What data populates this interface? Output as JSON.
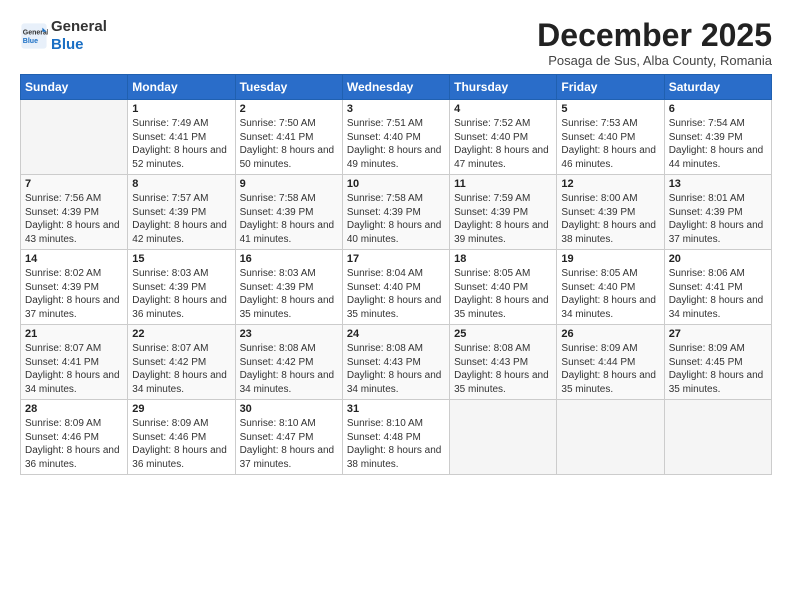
{
  "logo": {
    "line1": "General",
    "line2": "Blue"
  },
  "title": "December 2025",
  "location": "Posaga de Sus, Alba County, Romania",
  "weekdays": [
    "Sunday",
    "Monday",
    "Tuesday",
    "Wednesday",
    "Thursday",
    "Friday",
    "Saturday"
  ],
  "weeks": [
    [
      {
        "day": "",
        "sunrise": "",
        "sunset": "",
        "daylight": ""
      },
      {
        "day": "1",
        "sunrise": "Sunrise: 7:49 AM",
        "sunset": "Sunset: 4:41 PM",
        "daylight": "Daylight: 8 hours and 52 minutes."
      },
      {
        "day": "2",
        "sunrise": "Sunrise: 7:50 AM",
        "sunset": "Sunset: 4:41 PM",
        "daylight": "Daylight: 8 hours and 50 minutes."
      },
      {
        "day": "3",
        "sunrise": "Sunrise: 7:51 AM",
        "sunset": "Sunset: 4:40 PM",
        "daylight": "Daylight: 8 hours and 49 minutes."
      },
      {
        "day": "4",
        "sunrise": "Sunrise: 7:52 AM",
        "sunset": "Sunset: 4:40 PM",
        "daylight": "Daylight: 8 hours and 47 minutes."
      },
      {
        "day": "5",
        "sunrise": "Sunrise: 7:53 AM",
        "sunset": "Sunset: 4:40 PM",
        "daylight": "Daylight: 8 hours and 46 minutes."
      },
      {
        "day": "6",
        "sunrise": "Sunrise: 7:54 AM",
        "sunset": "Sunset: 4:39 PM",
        "daylight": "Daylight: 8 hours and 44 minutes."
      }
    ],
    [
      {
        "day": "7",
        "sunrise": "Sunrise: 7:56 AM",
        "sunset": "Sunset: 4:39 PM",
        "daylight": "Daylight: 8 hours and 43 minutes."
      },
      {
        "day": "8",
        "sunrise": "Sunrise: 7:57 AM",
        "sunset": "Sunset: 4:39 PM",
        "daylight": "Daylight: 8 hours and 42 minutes."
      },
      {
        "day": "9",
        "sunrise": "Sunrise: 7:58 AM",
        "sunset": "Sunset: 4:39 PM",
        "daylight": "Daylight: 8 hours and 41 minutes."
      },
      {
        "day": "10",
        "sunrise": "Sunrise: 7:58 AM",
        "sunset": "Sunset: 4:39 PM",
        "daylight": "Daylight: 8 hours and 40 minutes."
      },
      {
        "day": "11",
        "sunrise": "Sunrise: 7:59 AM",
        "sunset": "Sunset: 4:39 PM",
        "daylight": "Daylight: 8 hours and 39 minutes."
      },
      {
        "day": "12",
        "sunrise": "Sunrise: 8:00 AM",
        "sunset": "Sunset: 4:39 PM",
        "daylight": "Daylight: 8 hours and 38 minutes."
      },
      {
        "day": "13",
        "sunrise": "Sunrise: 8:01 AM",
        "sunset": "Sunset: 4:39 PM",
        "daylight": "Daylight: 8 hours and 37 minutes."
      }
    ],
    [
      {
        "day": "14",
        "sunrise": "Sunrise: 8:02 AM",
        "sunset": "Sunset: 4:39 PM",
        "daylight": "Daylight: 8 hours and 37 minutes."
      },
      {
        "day": "15",
        "sunrise": "Sunrise: 8:03 AM",
        "sunset": "Sunset: 4:39 PM",
        "daylight": "Daylight: 8 hours and 36 minutes."
      },
      {
        "day": "16",
        "sunrise": "Sunrise: 8:03 AM",
        "sunset": "Sunset: 4:39 PM",
        "daylight": "Daylight: 8 hours and 35 minutes."
      },
      {
        "day": "17",
        "sunrise": "Sunrise: 8:04 AM",
        "sunset": "Sunset: 4:40 PM",
        "daylight": "Daylight: 8 hours and 35 minutes."
      },
      {
        "day": "18",
        "sunrise": "Sunrise: 8:05 AM",
        "sunset": "Sunset: 4:40 PM",
        "daylight": "Daylight: 8 hours and 35 minutes."
      },
      {
        "day": "19",
        "sunrise": "Sunrise: 8:05 AM",
        "sunset": "Sunset: 4:40 PM",
        "daylight": "Daylight: 8 hours and 34 minutes."
      },
      {
        "day": "20",
        "sunrise": "Sunrise: 8:06 AM",
        "sunset": "Sunset: 4:41 PM",
        "daylight": "Daylight: 8 hours and 34 minutes."
      }
    ],
    [
      {
        "day": "21",
        "sunrise": "Sunrise: 8:07 AM",
        "sunset": "Sunset: 4:41 PM",
        "daylight": "Daylight: 8 hours and 34 minutes."
      },
      {
        "day": "22",
        "sunrise": "Sunrise: 8:07 AM",
        "sunset": "Sunset: 4:42 PM",
        "daylight": "Daylight: 8 hours and 34 minutes."
      },
      {
        "day": "23",
        "sunrise": "Sunrise: 8:08 AM",
        "sunset": "Sunset: 4:42 PM",
        "daylight": "Daylight: 8 hours and 34 minutes."
      },
      {
        "day": "24",
        "sunrise": "Sunrise: 8:08 AM",
        "sunset": "Sunset: 4:43 PM",
        "daylight": "Daylight: 8 hours and 34 minutes."
      },
      {
        "day": "25",
        "sunrise": "Sunrise: 8:08 AM",
        "sunset": "Sunset: 4:43 PM",
        "daylight": "Daylight: 8 hours and 35 minutes."
      },
      {
        "day": "26",
        "sunrise": "Sunrise: 8:09 AM",
        "sunset": "Sunset: 4:44 PM",
        "daylight": "Daylight: 8 hours and 35 minutes."
      },
      {
        "day": "27",
        "sunrise": "Sunrise: 8:09 AM",
        "sunset": "Sunset: 4:45 PM",
        "daylight": "Daylight: 8 hours and 35 minutes."
      }
    ],
    [
      {
        "day": "28",
        "sunrise": "Sunrise: 8:09 AM",
        "sunset": "Sunset: 4:46 PM",
        "daylight": "Daylight: 8 hours and 36 minutes."
      },
      {
        "day": "29",
        "sunrise": "Sunrise: 8:09 AM",
        "sunset": "Sunset: 4:46 PM",
        "daylight": "Daylight: 8 hours and 36 minutes."
      },
      {
        "day": "30",
        "sunrise": "Sunrise: 8:10 AM",
        "sunset": "Sunset: 4:47 PM",
        "daylight": "Daylight: 8 hours and 37 minutes."
      },
      {
        "day": "31",
        "sunrise": "Sunrise: 8:10 AM",
        "sunset": "Sunset: 4:48 PM",
        "daylight": "Daylight: 8 hours and 38 minutes."
      },
      {
        "day": "",
        "sunrise": "",
        "sunset": "",
        "daylight": ""
      },
      {
        "day": "",
        "sunrise": "",
        "sunset": "",
        "daylight": ""
      },
      {
        "day": "",
        "sunrise": "",
        "sunset": "",
        "daylight": ""
      }
    ]
  ],
  "colors": {
    "header_bg": "#2a6dc9",
    "header_text": "#ffffff",
    "accent": "#1a6fc4"
  }
}
